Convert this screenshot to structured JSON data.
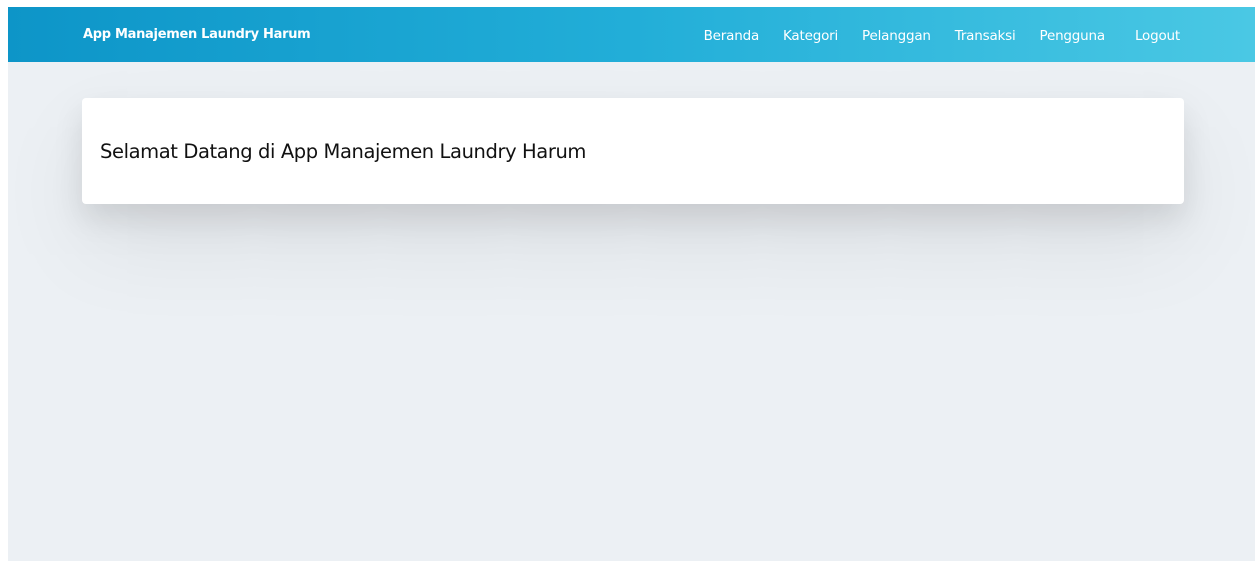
{
  "navbar": {
    "brand": "App Manajemen Laundry Harum",
    "links": [
      {
        "label": "Beranda"
      },
      {
        "label": "Kategori"
      },
      {
        "label": "Pelanggan"
      },
      {
        "label": "Transaksi"
      },
      {
        "label": "Pengguna"
      },
      {
        "label": "Logout"
      }
    ],
    "gradient_start": "#0d95c8",
    "gradient_end": "#4ac8e4"
  },
  "main": {
    "welcome_title": "Selamat Datang di App Manajemen Laundry Harum"
  },
  "colors": {
    "page_background": "#ecf0f4",
    "card_background": "#ffffff",
    "text_primary": "#111111"
  }
}
